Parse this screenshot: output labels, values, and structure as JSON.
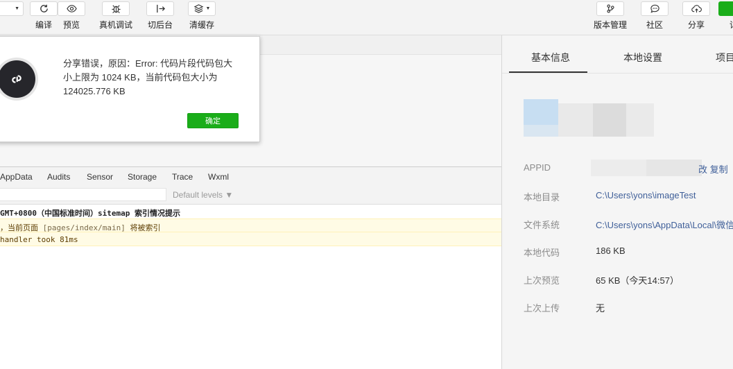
{
  "toolbar": {
    "compile_label": "编译",
    "preview_label": "预览",
    "remote_debug_label": "真机调试",
    "background_label": "切后台",
    "clear_cache_label": "清缓存",
    "version_label": "版本管理",
    "community_label": "社区",
    "share_label": "分享",
    "edge_label": "详"
  },
  "dialog": {
    "message_line1": "分享错误，原因：Error: 代码片段代码包大",
    "message_line2": "小上限为 1024 KB，当前代码包大小为",
    "message_line3": "124025.776 KB",
    "ok_label": "确定"
  },
  "devtools": {
    "tabs": [
      "AppData",
      "Audits",
      "Sensor",
      "Storage",
      "Trace",
      "Wxml"
    ],
    "levels_label": "Default levels ▼",
    "console": {
      "line1": "GMT+0800（中国标准时间）sitemap 索引情况提示",
      "line2_prefix": "，当前页面 ",
      "line2_path": "[pages/index/main]",
      "line2_suffix": " 将被索引",
      "line3": "handler took 81ms"
    }
  },
  "panel": {
    "tabs": [
      "基本信息",
      "本地设置",
      "项目"
    ],
    "copy_text": "改 复制",
    "rows": [
      {
        "label": "APPID",
        "value": ""
      },
      {
        "label": "本地目录",
        "value": "C:\\Users\\yons\\imageTest"
      },
      {
        "label": "文件系统",
        "value": "C:\\Users\\yons\\AppData\\Local\\微信"
      },
      {
        "label": "本地代码",
        "value": "186 KB"
      },
      {
        "label": "上次预览",
        "value": "65 KB（今天14:57）"
      },
      {
        "label": "上次上传",
        "value": "无"
      }
    ]
  },
  "colors": {
    "primary_green": "#1aad19",
    "link_blue": "#3f5f99"
  }
}
